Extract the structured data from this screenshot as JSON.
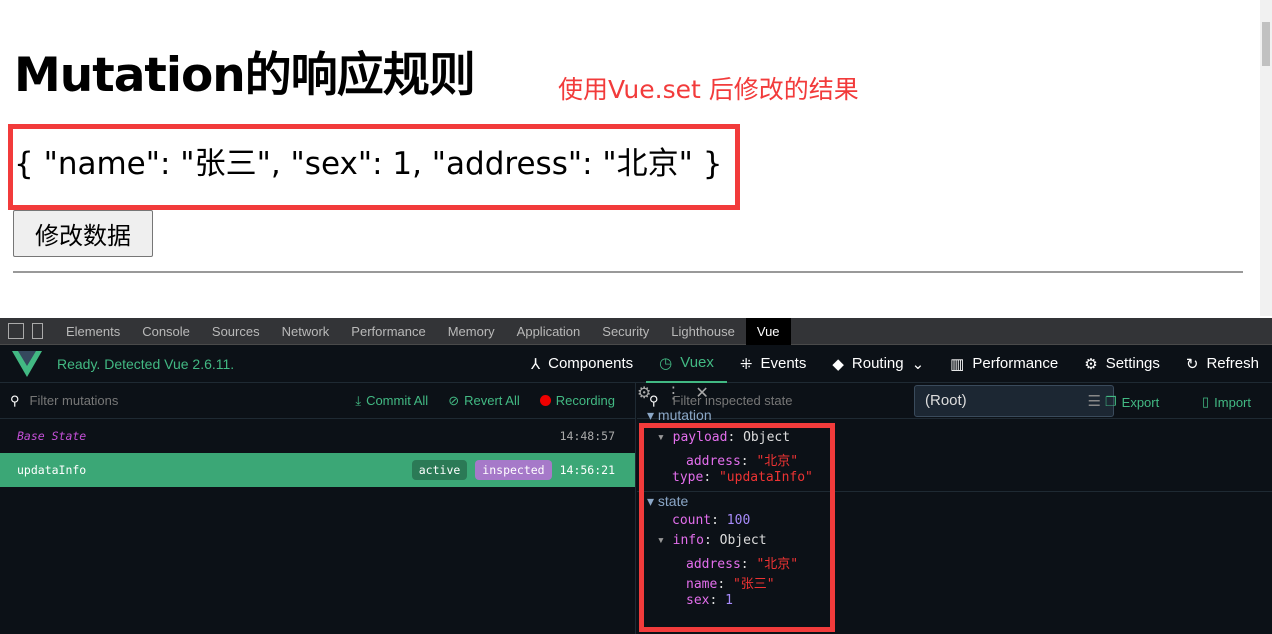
{
  "page": {
    "title": "Mutation的响应规则",
    "note": "使用Vue.set 后修改的结果",
    "json_text": "{ \"name\": \"张三\", \"sex\": 1, \"address\": \"北京\" }",
    "button": "修改数据"
  },
  "devtools": {
    "tabs": [
      "Elements",
      "Console",
      "Sources",
      "Network",
      "Performance",
      "Memory",
      "Application",
      "Security",
      "Lighthouse",
      "Vue"
    ],
    "active_tab": "Vue",
    "status": "Ready. Detected Vue 2.6.11.",
    "nav": [
      "Components",
      "Vuex",
      "Events",
      "Routing",
      "Performance",
      "Settings",
      "Refresh"
    ],
    "active_nav": "Vuex",
    "filter_mutations": "Filter mutations",
    "commit_all": "Commit All",
    "revert_all": "Revert All",
    "recording": "Recording",
    "mutations": [
      {
        "name": "Base State",
        "time": "14:48:57"
      },
      {
        "name": "updataInfo",
        "time": "14:56:21",
        "badges": [
          "active",
          "inspected"
        ]
      }
    ],
    "filter_state": "Filter inspected state",
    "root_select": "(Root)",
    "export": "Export",
    "import": "Import",
    "tree": {
      "mutation": "mutation",
      "payload": "payload",
      "object": "Object",
      "address": "address",
      "beijing": "\"北京\"",
      "type": "type",
      "type_val": "\"updataInfo\"",
      "state": "state",
      "count": "count",
      "count_val": "100",
      "info": "info",
      "name": "name",
      "name_val": "\"张三\"",
      "sex": "sex",
      "sex_val": "1"
    },
    "colors": {
      "accent": "#42b983",
      "highlight": "#f23b3b",
      "inspected": "#a679c9"
    }
  }
}
